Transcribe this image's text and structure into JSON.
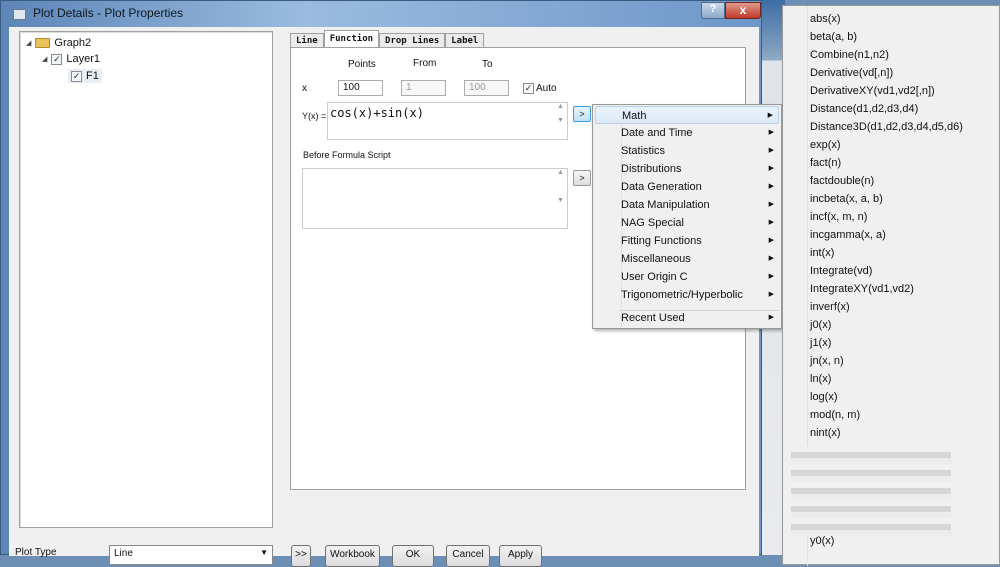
{
  "window": {
    "title": "Plot Details - Plot Properties",
    "help": "?",
    "close": "x"
  },
  "tree": {
    "root": "Graph2",
    "layer": "Layer1",
    "plot": "F1"
  },
  "tabs": [
    "Line",
    "Function",
    "Drop Lines",
    "Label"
  ],
  "function": {
    "points_label": "Points",
    "from_label": "From",
    "to_label": "To",
    "x_label": "x",
    "points": "100",
    "from": "1",
    "to": "100",
    "auto_label": "Auto",
    "auto_checked": true,
    "y_label": "Y(x) =",
    "formula": "cos(x)+sin(x)",
    "script_label": "Before Formula Script",
    "script": "",
    "arrow": ">"
  },
  "menu": {
    "items": [
      "Math",
      "Date and Time",
      "Statistics",
      "Distributions",
      "Data Generation",
      "Data Manipulation",
      "NAG Special",
      "Fitting Functions",
      "Miscellaneous",
      "User Origin C",
      "Trigonometric/Hyperbolic"
    ],
    "recent": "Recent Used",
    "highlighted": "Math"
  },
  "math_functions": [
    "abs(x)",
    "beta(a, b)",
    "Combine(n1,n2)",
    "Derivative(vd[,n])",
    "DerivativeXY(vd1,vd2[,n])",
    "Distance(d1,d2,d3,d4)",
    "Distance3D(d1,d2,d3,d4,d5,d6)",
    "exp(x)",
    "fact(n)",
    "factdouble(n)",
    "incbeta(x, a, b)",
    "incf(x, m, n)",
    "incgamma(x, a)",
    "int(x)",
    "Integrate(vd)",
    "IntegrateXY(vd1,vd2)",
    "inverf(x)",
    "j0(x)",
    "j1(x)",
    "jn(x, n)",
    "ln(x)",
    "log(x)",
    "mod(n, m)",
    "nint(x)",
    "y0(x)"
  ],
  "bottom": {
    "plot_type_label": "Plot Type",
    "plot_type": "Line",
    "expand": ">>",
    "workbook": "Workbook",
    "ok": "OK",
    "cancel": "Cancel",
    "apply": "Apply"
  }
}
